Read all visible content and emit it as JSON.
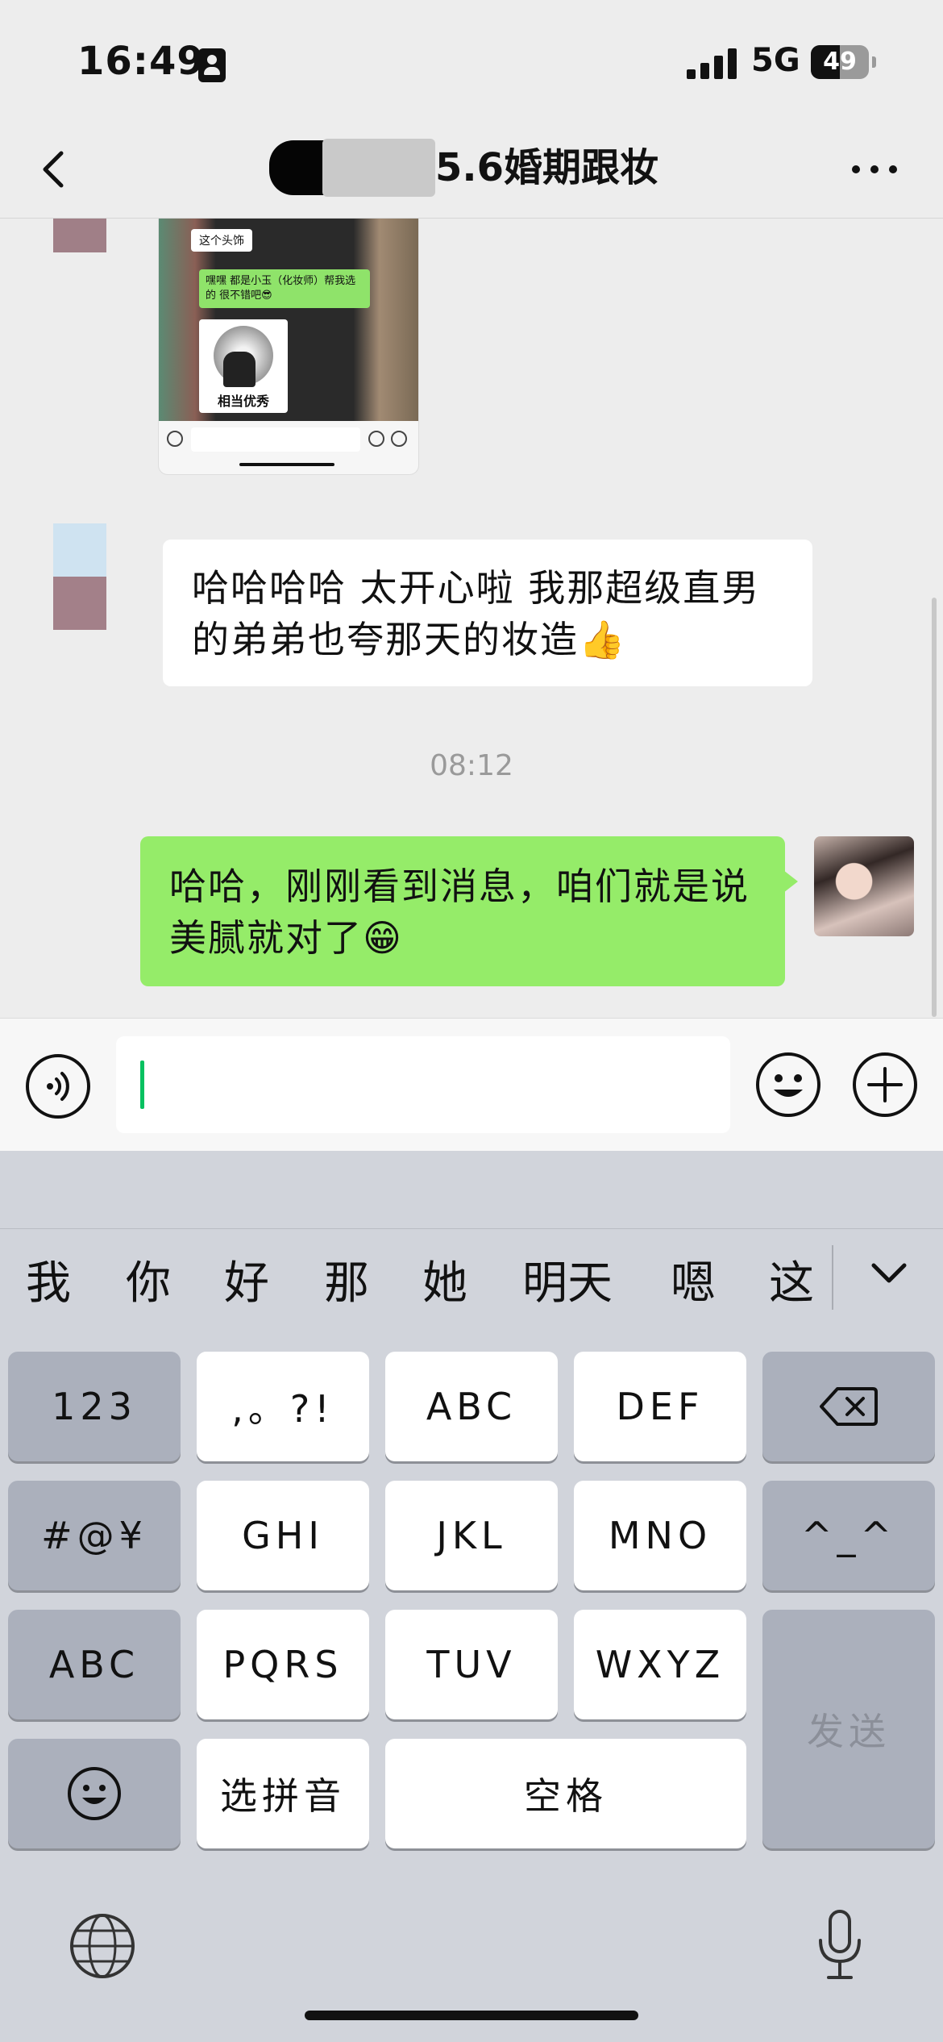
{
  "status_bar": {
    "time": "16:49",
    "network": "5G",
    "battery": "49"
  },
  "header": {
    "title": "5.6婚期跟妆",
    "back_icon": "chevron-left-icon",
    "more_icon": "more-dots-icon"
  },
  "messages": {
    "screenshot": {
      "bubble1": "这个头饰",
      "bubble2": "嘿嘿 都是小玉（化妆师）帮我选的 很不错吧😎",
      "sticker_label": "相当优秀"
    },
    "incoming_text": "哈哈哈哈  太开心啦   我那超级直男的弟弟也夸那天的妆造👍",
    "timestamp": "08:12",
    "outgoing_text": "哈哈，刚刚看到消息，咱们就是说美腻就对了😁"
  },
  "input_bar": {
    "voice_icon": "voice-icon",
    "emoji_icon": "emoji-icon",
    "plus_icon": "plus-circle-icon"
  },
  "keyboard": {
    "candidates": [
      "我",
      "你",
      "好",
      "那",
      "她",
      "明天",
      "嗯",
      "这"
    ],
    "keys": {
      "numbers": "123",
      "punct": ",。?!",
      "abc": "ABC",
      "def": "DEF",
      "symbols": "#@¥",
      "ghi": "GHI",
      "jkl": "JKL",
      "mno": "MNO",
      "face": "^_^",
      "abc_mode": "ABC",
      "pqrs": "PQRS",
      "tuv": "TUV",
      "wxyz": "WXYZ",
      "send": "发送",
      "pinyin": "选拼音",
      "space": "空格"
    }
  },
  "colors": {
    "wechat_green": "#95ec69",
    "caret": "#07c160"
  }
}
